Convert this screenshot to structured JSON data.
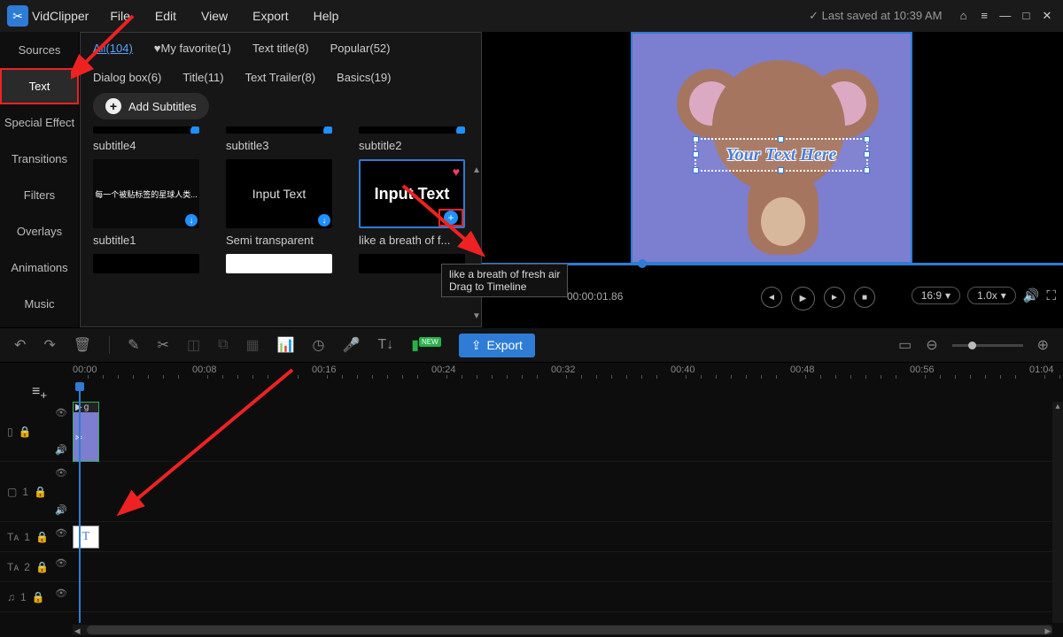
{
  "app": {
    "name": "VidClipper",
    "saved": "Last saved at 10:39 AM"
  },
  "menu": {
    "file": "File",
    "edit": "Edit",
    "view": "View",
    "export": "Export",
    "help": "Help"
  },
  "sidebar": {
    "items": [
      {
        "label": "Sources"
      },
      {
        "label": "Text"
      },
      {
        "label": "Special Effect"
      },
      {
        "label": "Transitions"
      },
      {
        "label": "Filters"
      },
      {
        "label": "Overlays"
      },
      {
        "label": "Animations"
      },
      {
        "label": "Music"
      }
    ]
  },
  "browser": {
    "tabs": {
      "all": "All(104)",
      "fav": "My favorite(1)",
      "texttitle": "Text title(8)",
      "popular": "Popular(52)",
      "dialog": "Dialog box(6)",
      "title": "Title(11)",
      "trailer": "Text Trailer(8)",
      "basics": "Basics(19)"
    },
    "addSubtitles": "Add Subtitles",
    "favIcon": "♥",
    "row1": {
      "a": "subtitle4",
      "b": "subtitle3",
      "c": "subtitle2"
    },
    "row2": {
      "a": "subtitle1",
      "b": "Semi transparent",
      "c": "like a breath of f...",
      "bThumb": "Input Text",
      "cThumb": "Input Text",
      "aThumb": "每一个被贴标签的星球人类..."
    },
    "tooltip": {
      "line1": "like a breath of fresh air",
      "line2": "Drag to Timeline"
    }
  },
  "preview": {
    "text": "Your Text Here",
    "timecode": "00:00:01.86",
    "ratio": "16:9",
    "speed": "1.0x"
  },
  "toolbar": {
    "export": "Export",
    "newBadge": "NEW"
  },
  "timeline": {
    "ticks": [
      "00:00",
      "00:08",
      "00:16",
      "00:24",
      "00:32",
      "00:40",
      "00:48",
      "00:56",
      "01:04"
    ],
    "videoClip": "g",
    "textClip": "T",
    "heads": {
      "t1": "1",
      "t2": "1",
      "t3": "2",
      "t4": "1"
    }
  }
}
